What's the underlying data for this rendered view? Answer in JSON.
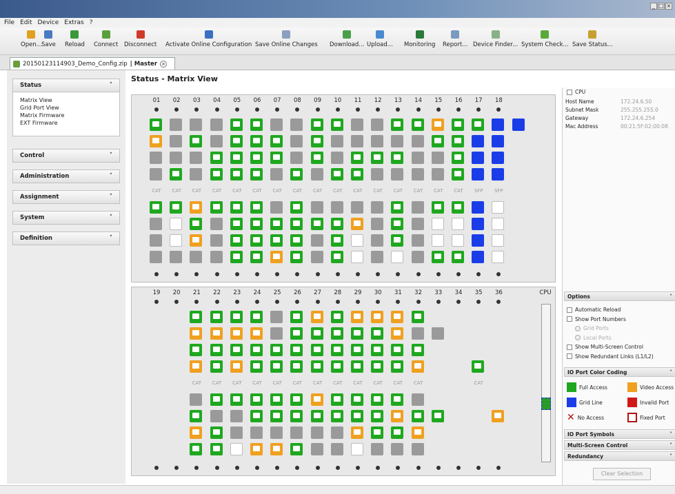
{
  "window": {
    "controls": [
      "_",
      "□",
      "×"
    ]
  },
  "menu": [
    "File",
    "Edit",
    "Device",
    "Extras",
    "?"
  ],
  "toolbar": [
    {
      "label": "Open...",
      "icon": "folder-icon",
      "color": "#e0a020"
    },
    {
      "label": "Save",
      "icon": "save-icon",
      "color": "#4a7bc0"
    },
    {
      "label": "Reload",
      "icon": "reload-icon",
      "color": "#3a9a3a"
    },
    {
      "label": "Connect",
      "icon": "connect-icon",
      "color": "#5aa03a"
    },
    {
      "label": "Disconnect",
      "icon": "disconnect-icon",
      "color": "#d03a2a"
    },
    {
      "label": "Activate Online Configuration",
      "icon": "activate-icon",
      "color": "#3a70c0"
    },
    {
      "label": "Save Online Changes",
      "icon": "save-online-icon",
      "color": "#8aa0c0"
    },
    {
      "label": "Download...",
      "icon": "download-icon",
      "color": "#4aa04a"
    },
    {
      "label": "Upload...",
      "icon": "upload-icon",
      "color": "#4a8ad0"
    },
    {
      "label": "Monitoring",
      "icon": "monitor-icon",
      "color": "#2a7a3a"
    },
    {
      "label": "Report...",
      "icon": "report-icon",
      "color": "#7a9ac0"
    },
    {
      "label": "Device Finder...",
      "icon": "device-finder-icon",
      "color": "#8ab08a"
    },
    {
      "label": "System Check...",
      "icon": "check-icon",
      "color": "#5aaa3a"
    },
    {
      "label": "Save Status...",
      "icon": "save-status-icon",
      "color": "#c8a030"
    }
  ],
  "tab": {
    "label": "20150123114903_Demo_Config.zip",
    "suffix": "| Master"
  },
  "sidebar": {
    "status": {
      "label": "Status",
      "items": [
        "Matrix View",
        "Grid Port View",
        "Matrix Firmware",
        "EXT Firmware"
      ]
    },
    "sections": [
      "Control",
      "Administration",
      "Assignment",
      "System",
      "Definition"
    ]
  },
  "main": {
    "title": "Status - Matrix View",
    "cpu_label": "CPU",
    "cat_label": "CAT",
    "sfp_label": "SFP"
  },
  "columns_top": [
    "01",
    "02",
    "03",
    "04",
    "05",
    "06",
    "07",
    "08",
    "09",
    "10",
    "11",
    "12",
    "13",
    "14",
    "15",
    "16",
    "17",
    "18"
  ],
  "columns_bot": [
    "19",
    "20",
    "21",
    "22",
    "23",
    "24",
    "25",
    "26",
    "27",
    "28",
    "29",
    "30",
    "31",
    "32",
    "33",
    "34",
    "35",
    "36"
  ],
  "cpu_info": {
    "title": "CPU",
    "rows": [
      {
        "k": "Host Name",
        "v": "172.24.6.50"
      },
      {
        "k": "Subnet Mask",
        "v": "255.255.255.0"
      },
      {
        "k": "Gateway",
        "v": "172.24.6.254"
      },
      {
        "k": "Mac Address",
        "v": "00:21:5F:02:00:08"
      }
    ]
  },
  "options": {
    "title": "Options",
    "items": [
      {
        "label": "Automatic Reload",
        "type": "check"
      },
      {
        "label": "Show Port Numbers",
        "type": "check"
      },
      {
        "label": "Grid Ports",
        "type": "radio"
      },
      {
        "label": "Local Ports",
        "type": "radio"
      },
      {
        "label": "Show Multi-Screen Control",
        "type": "check"
      },
      {
        "label": "Show Redundant Links (L1/L2)",
        "type": "check"
      }
    ]
  },
  "legend": {
    "title": "IO Port Color Coding",
    "items": [
      {
        "label": "Full Access",
        "color": "#1fa81f"
      },
      {
        "label": "Video Access",
        "color": "#f0a020"
      },
      {
        "label": "Grid Line",
        "color": "#1a3de8"
      },
      {
        "label": "Invalid Port",
        "color": "#d01818"
      },
      {
        "label": "No Access",
        "color": "#b01010"
      },
      {
        "label": "Fixed Port",
        "color": "#b01010"
      }
    ]
  },
  "collapsed_sections": [
    "IO Port Symbols",
    "Multi-Screen Control",
    "Redundancy"
  ],
  "clear_button": "Clear Selection",
  "colors": {
    "green": "#1fa81f",
    "orange": "#f0a020",
    "blue": "#1a3de8",
    "gray": "#9a9a9a"
  }
}
